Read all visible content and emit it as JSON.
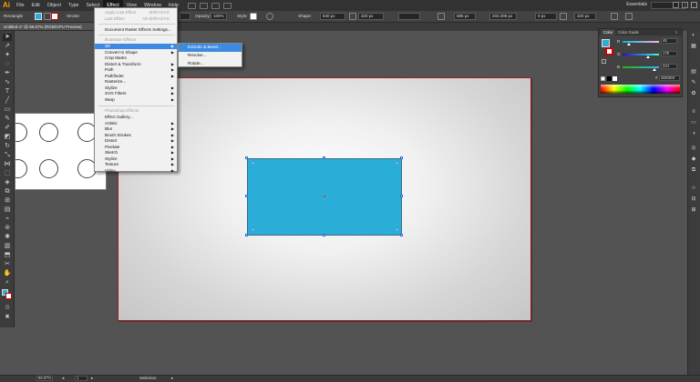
{
  "app": {
    "logo": "Ai",
    "workspace": "Essentials",
    "window_controls": [
      "minimize-icon",
      "maximize-icon",
      "close-icon"
    ]
  },
  "menubar": [
    "File",
    "Edit",
    "Object",
    "Type",
    "Select",
    "Effect",
    "View",
    "Window",
    "Help"
  ],
  "controlbar": {
    "selection_label": "Rectangle",
    "fill_color": "#2aaed8",
    "stroke_label": "Stroke:",
    "style_label": "Style:",
    "opacity_label": "Opacity:",
    "opacity_value": "100%",
    "shape_label": "Shape:",
    "width_value": "840 px",
    "height_value": "320 px",
    "x_value": "885 px",
    "y_value": "403.399 px",
    "w_value": "0 px",
    "h_value": "320 px"
  },
  "document_tab": "Untitled-1* @ 66.67% (RGB/GPU Preview)",
  "effect_menu": {
    "items": [
      {
        "label": "Apply Last Effect",
        "shortcut": "Shift+Ctrl+E",
        "disabled": true
      },
      {
        "label": "Last Effect",
        "shortcut": "Alt+Shift+Ctrl+E",
        "disabled": true
      },
      {
        "label": "Document Raster Effects Settings..."
      },
      {
        "label": "Illustrator Effects",
        "heading": true
      },
      {
        "label": "3D",
        "submenu": true,
        "highlighted": true
      },
      {
        "label": "Convert to Shape",
        "submenu": true
      },
      {
        "label": "Crop Marks"
      },
      {
        "label": "Distort & Transform",
        "submenu": true
      },
      {
        "label": "Path",
        "submenu": true
      },
      {
        "label": "Pathfinder",
        "submenu": true
      },
      {
        "label": "Rasterize..."
      },
      {
        "label": "Stylize",
        "submenu": true
      },
      {
        "label": "SVG Filters",
        "submenu": true
      },
      {
        "label": "Warp",
        "submenu": true
      },
      {
        "label": "Photoshop Effects",
        "heading": true
      },
      {
        "label": "Effect Gallery..."
      },
      {
        "label": "Artistic",
        "submenu": true
      },
      {
        "label": "Blur",
        "submenu": true
      },
      {
        "label": "Brush Strokes",
        "submenu": true
      },
      {
        "label": "Distort",
        "submenu": true
      },
      {
        "label": "Pixelate",
        "submenu": true
      },
      {
        "label": "Sketch",
        "submenu": true
      },
      {
        "label": "Stylize",
        "submenu": true
      },
      {
        "label": "Texture",
        "submenu": true
      },
      {
        "label": "Video",
        "submenu": true
      }
    ]
  },
  "submenu_3d": {
    "items": [
      "Extrude & Bevel...",
      "Revolve...",
      "Rotate..."
    ]
  },
  "color_panel": {
    "tabs": [
      "Color",
      "Color Guide"
    ],
    "fill_color": "#2aaed8",
    "r": {
      "label": "R",
      "value": "46",
      "fraction": 0.18
    },
    "g": {
      "label": "G",
      "value": "179",
      "fraction": 0.7
    },
    "b": {
      "label": "B",
      "value": "224",
      "fraction": 0.88
    },
    "hex": "2EB3E0"
  },
  "statusbar": {
    "zoom": "66.67%",
    "page": "1",
    "tool": "Selection"
  }
}
